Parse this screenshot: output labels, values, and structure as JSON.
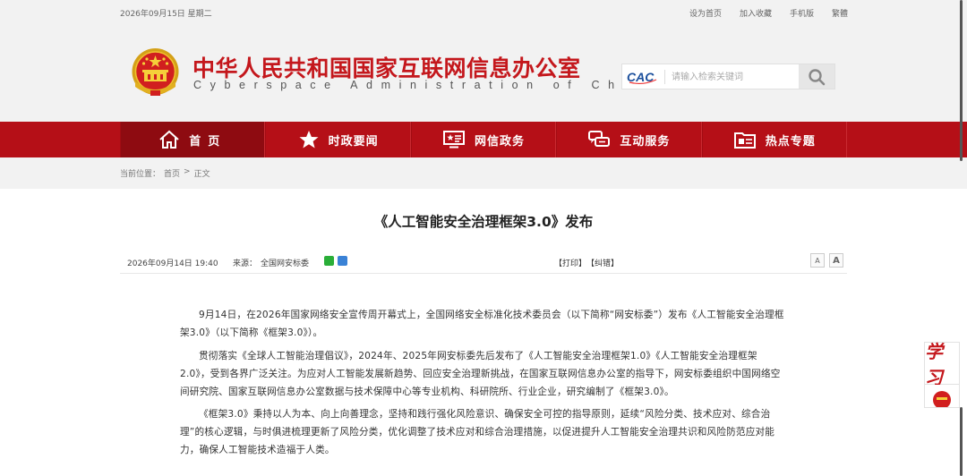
{
  "topbar": {
    "date": "2026年09月15日 星期二",
    "links": [
      "设为首页",
      "加入收藏",
      "手机版",
      "繁體"
    ]
  },
  "header": {
    "title_cn": "中华人民共和国国家互联网信息办公室",
    "title_en": "Cyberspace Administration of China",
    "logo_text": "CAC",
    "search_placeholder": "请输入检索关键词"
  },
  "nav": {
    "items": [
      {
        "label": "首页",
        "icon": "home-icon"
      },
      {
        "label": "时政要闻",
        "icon": "star-icon"
      },
      {
        "label": "网信政务",
        "icon": "screen-icon"
      },
      {
        "label": "互动服务",
        "icon": "chat-icon"
      },
      {
        "label": "热点专题",
        "icon": "folder-icon"
      }
    ]
  },
  "breadcrumb": {
    "label": "当前位置：",
    "home": "首页",
    "sep": ">",
    "current": "正文"
  },
  "article": {
    "title": "《人工智能安全治理框架3.0》发布",
    "date": "2026年09月14日 19:40",
    "source_label": "来源：",
    "source": "全国网安标委",
    "print": "【打印】",
    "correct": "【纠错】",
    "font_small": "A",
    "font_large": "A",
    "paragraphs": [
      "9月14日，在2026年国家网络安全宣传周开幕式上，全国网络安全标准化技术委员会（以下简称“网安标委”）发布《人工智能安全治理框架3.0》（以下简称《框架3.0》）。",
      "贯彻落实《全球人工智能治理倡议》，2024年、2025年网安标委先后发布了《人工智能安全治理框架1.0》《人工智能安全治理框架2.0》，受到各界广泛关注。为应对人工智能发展新趋势、回应安全治理新挑战，在国家互联网信息办公室的指导下，网安标委组织中国网络空间研究院、国家互联网信息办公室数据与技术保障中心等专业机构、科研院所、行业企业，研究编制了《框架3.0》。",
      "《框架3.0》秉持以人为本、向上向善理念，坚持和践行强化风险意识、确保安全可控的指导原则，延续“风险分类、技术应对、综合治理”的核心逻辑，与时俱进梳理更新了风险分类，优化调整了技术应对和综合治理措施，以促进提升人工智能安全治理共识和风险防范应对能力，确保人工智能技术造福于人类。"
    ]
  },
  "float": {
    "study_label": "学习"
  },
  "colors": {
    "brand_red": "#c4171c",
    "nav_red": "#b50f17"
  }
}
